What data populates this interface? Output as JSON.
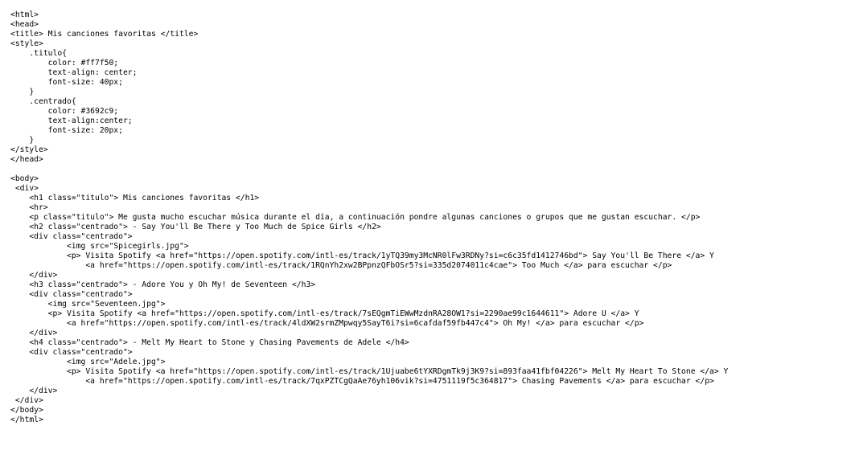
{
  "code_lines": [
    "<html>",
    "<head>",
    "<title> Mis canciones favoritas </title>",
    "<style>",
    "    .titulo{",
    "        color: #ff7f50;",
    "        text-align: center;",
    "        font-size: 40px;",
    "    }",
    "    .centrado{",
    "        color: #3692c9;",
    "        text-align:center;",
    "        font-size: 20px;",
    "    }",
    "</style>",
    "</head>",
    "",
    "<body>",
    " <div>",
    "    <h1 class=\"titulo\"> Mis canciones favoritas </h1>",
    "    <hr>",
    "    <p class=\"titulo\"> Me gusta mucho escuchar música durante el día, a continuación pondre algunas canciones o grupos que me gustan escuchar. </p>",
    "    <h2 class=\"centrado\"> - Say You'll Be There y Too Much de Spice Girls </h2>",
    "    <div class=\"centrado\">",
    "            <img src=\"Spicegirls.jpg\">",
    "            <p> Visita Spotify <a href=\"https://open.spotify.com/intl-es/track/1yTQ39my3McNR0lFw3RDNy?si=c6c35fd1412746bd\"> Say You'll Be There </a> Y",
    "                <a href=\"https://open.spotify.com/intl-es/track/1RQnYh2xw2BPpnzQFbOSr5?si=335d2074011c4cae\"> Too Much </a> para escuchar </p>",
    "    </div>",
    "    <h3 class=\"centrado\"> - Adore You y Oh My! de Seventeen </h3>",
    "    <div class=\"centrado\">",
    "        <img src=\"Seventeen.jpg\">",
    "        <p> Visita Spotify <a href=\"https://open.spotify.com/intl-es/track/7sEQgmTiEWwMzdnRA28OW1?si=2290ae99c1644611\"> Adore U </a> Y",
    "            <a href=\"https://open.spotify.com/intl-es/track/4ldXW2srmZMpwqy5SayT6i?si=6cafdaf59fb447c4\"> Oh My! </a> para escuchar </p>",
    "    </div>",
    "    <h4 class=\"centrado\"> - Melt My Heart to Stone y Chasing Pavements de Adele </h4>",
    "    <div class=\"centrado\">",
    "            <img src=\"Adele.jpg\">",
    "            <p> Visita Spotify <a href=\"https://open.spotify.com/intl-es/track/1Ujuabe6tYXRDgmTk9j3K9?si=893faa41fbf04226\"> Melt My Heart To Stone </a> Y",
    "                <a href=\"https://open.spotify.com/intl-es/track/7qxPZTCgQaAe76yh106vik?si=4751119f5c364817\"> Chasing Pavements </a> para escuchar </p>",
    "    </div>",
    " </div>",
    "</body>",
    "</html>"
  ]
}
